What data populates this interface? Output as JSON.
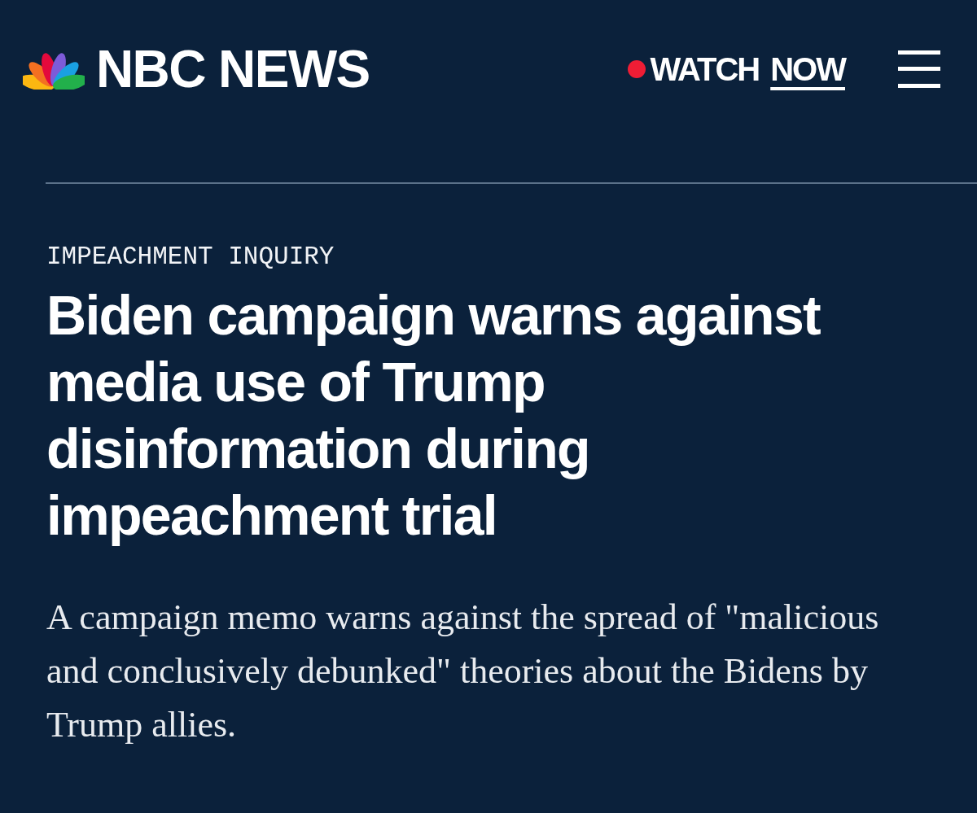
{
  "header": {
    "logo_text": "NBC NEWS",
    "watch_link": {
      "label": "WATCH",
      "emphasis": "NOW"
    }
  },
  "article": {
    "eyebrow": "IMPEACHMENT INQUIRY",
    "headline": "Biden campaign warns against media use of Trump disinformation during impeachment trial",
    "dek": "A campaign memo warns against the spread of \"malicious and conclusively debunked\" theories about the Bidens by Trump allies."
  }
}
